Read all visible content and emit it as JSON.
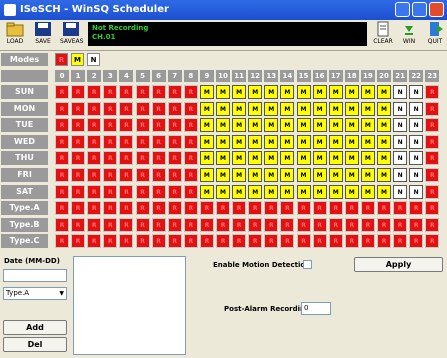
{
  "window": {
    "title": "ISeSCH - WinSQ Scheduler"
  },
  "toolbar": {
    "load": "LOAD",
    "save": "SAVE",
    "saveas": "SAVEAS",
    "clear": "CLEAR",
    "win": "WIN",
    "quit": "QUIT"
  },
  "status": {
    "line1": "Not Recording",
    "line2": "CH.01"
  },
  "modes": {
    "label": "Modes",
    "items": [
      "R",
      "M",
      "N"
    ]
  },
  "hours": [
    "0",
    "1",
    "2",
    "3",
    "4",
    "5",
    "6",
    "7",
    "8",
    "9",
    "10",
    "11",
    "12",
    "13",
    "14",
    "15",
    "16",
    "17",
    "18",
    "19",
    "20",
    "21",
    "22",
    "23"
  ],
  "rows": [
    {
      "label": "SUN",
      "cells": "RRRRRRRRRMMMMMMMMMMMMNNR"
    },
    {
      "label": "MON",
      "cells": "RRRRRRRRRMMMMMMMMMMMMNNR"
    },
    {
      "label": "TUE",
      "cells": "RRRRRRRRRMMMMMMMMMMMMNNR"
    },
    {
      "label": "WED",
      "cells": "RRRRRRRRRMMMMMMMMMMMMNNR"
    },
    {
      "label": "THU",
      "cells": "RRRRRRRRRMMMMMMMMMMMMNNR"
    },
    {
      "label": "FRI",
      "cells": "RRRRRRRRRMMMMMMMMMMMMNNR"
    },
    {
      "label": "SAT",
      "cells": "RRRRRRRRRMMMMMMMMMMMMNNR"
    },
    {
      "label": "Type.A",
      "cells": "RRRRRRRRRRRRRRRRRRRRRRRR"
    },
    {
      "label": "Type.B",
      "cells": "RRRRRRRRRRRRRRRRRRRRRRRR"
    },
    {
      "label": "Type.C",
      "cells": "RRRRRRRRRRRRRRRRRRRRRRRR"
    }
  ],
  "panel": {
    "date_label": "Date (MM-DD)",
    "type_value": "Type.A",
    "add": "Add",
    "del": "Del",
    "motion_label": "Enable Motion Detection",
    "apply": "Apply",
    "post_alarm_label": "Post-Alarm Recording",
    "post_alarm_value": "0"
  },
  "colors": {
    "R": "#e31212",
    "M": "#ffff00",
    "N": "#ffffff"
  }
}
